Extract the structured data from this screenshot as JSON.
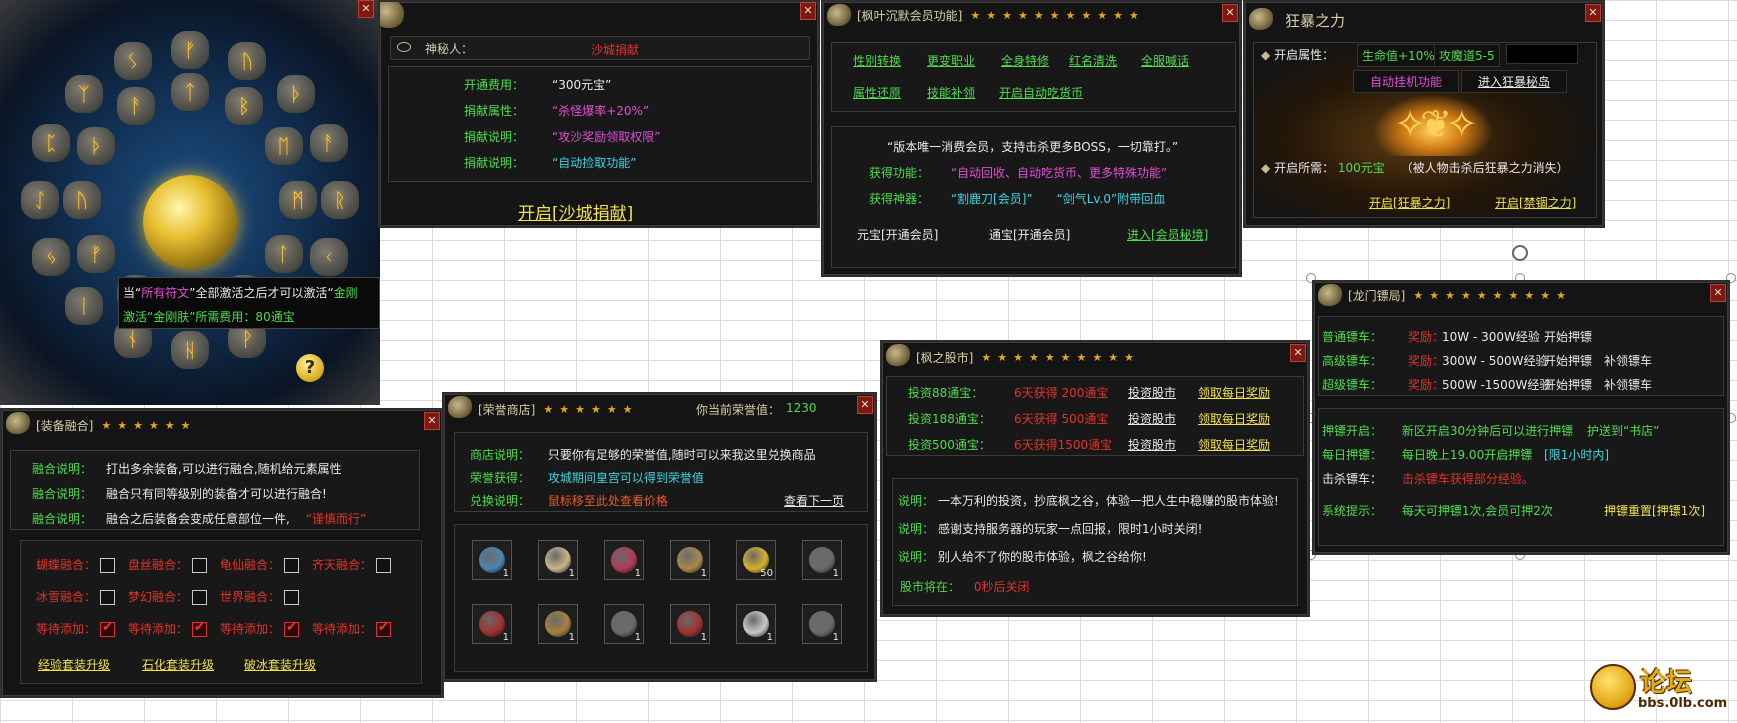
{
  "rune_panel": {
    "tooltip_line1_a": "当“",
    "tooltip_line1_rune": "所有符文",
    "tooltip_line1_b": "”全部激活之后才可以激活“",
    "tooltip_line1_c": "金刚",
    "tooltip_line2": "激活“金刚肤”所需费用：80通宝",
    "rune_glyphs": [
      "ᚠ",
      "ᚢ",
      "ᚦ",
      "ᚨ",
      "ᚱ",
      "ᚲ",
      "ᚷ",
      "ᚹ",
      "ᚺ",
      "ᚾ",
      "ᛁ",
      "ᛃ",
      "ᛇ",
      "ᛈ",
      "ᛉ",
      "ᛊ",
      "ᛏ",
      "ᛒ",
      "ᛖ",
      "ᛗ",
      "ᛚ",
      "ᛜ",
      "ᛞ",
      "ᛟ"
    ]
  },
  "shacheng": {
    "mystery_label": "神秘人：",
    "mystery_value": "沙城捐献",
    "rows": [
      {
        "label": "开通费用：",
        "value": "“300元宝”",
        "color": "#e8e8e8"
      },
      {
        "label": "捐献属性：",
        "value": "“杀怪爆率+20%”",
        "color": "#e04fd6"
      },
      {
        "label": "捐献说明：",
        "value": "“攻沙奖励领取权限”",
        "color": "#e04fd6"
      },
      {
        "label": "捐献说明：",
        "value": "“自动捡取功能”",
        "color": "#3fd6e0"
      }
    ],
    "open_link": "开启[沙城捐献]"
  },
  "member": {
    "title": "[枫叶沉默会员功能]",
    "stars": "★★★★★★★★★★★",
    "links_row1": [
      "性别转换",
      "更变职业",
      "全身特修",
      "红名清洗",
      "全服喊话"
    ],
    "links_row2": [
      "属性还原",
      "技能补领",
      "开启自动吃货币"
    ],
    "slogan": "“版本唯一消费会员，支持击杀更多BOSS，一切靠打。”",
    "func_label": "获得功能：",
    "func_value": "“自动回收、自动吃货币、更多特殊功能”",
    "weapon_label": "获得神器：",
    "weapon_value1": "“割鹿刀[会员]”",
    "weapon_value2": "“剑气Lv.0”附带回血",
    "btn_yuanbao": "元宝[开通会员]",
    "btn_tongbao": "通宝[开通会员]",
    "enter_link": "进入[会员秘境]"
  },
  "berserk": {
    "title": "狂暴之力",
    "attr_label": "开启属性：",
    "attr_hp": "生命值+10%",
    "attr_atk": "攻魔道5-5",
    "auto_btn": "自动挂机功能",
    "enter_island": "进入狂暴秘岛",
    "cost_label": "开启所需：",
    "cost_value": "100元宝",
    "cost_note": "（被人物击杀后狂暴之力消失）",
    "open_link": "开启[狂暴之力]",
    "ban_link": "开启[禁锢之力]"
  },
  "escort": {
    "title": "[龙门镖局]",
    "stars": "★★★★★★★★★★",
    "rows": [
      {
        "type": "普通镖车：",
        "reward_label": "奖励：",
        "reward": "10W - 300W经验",
        "a1": "开始押镖",
        "a2": ""
      },
      {
        "type": "高级镖车：",
        "reward_label": "奖励：",
        "reward": "300W - 500W经验",
        "a1": "开始押镖",
        "a2": "补领镖车"
      },
      {
        "type": "超级镖车：",
        "reward_label": "奖励：",
        "reward": "500W -1500W经验",
        "a1": "开始押镖",
        "a2": "补领镖车"
      }
    ],
    "open_label": "押镖开启：",
    "open_value": "新区开启30分钟后可以进行押镖",
    "open_value2": "护送到“书店”",
    "daily_label": "每日押镖：",
    "daily_value": "每日晚上19.00开启押镖",
    "daily_value2": "[限1小时内]",
    "kill_label": "击杀镖车：",
    "kill_value": "击杀镖车获得部分经验。",
    "sys_label": "系统提示：",
    "sys_value": "每天可押镖1次,会员可押2次",
    "reset_link": "押镖重置[押镖1次]"
  },
  "stock": {
    "title": "[枫之股市]",
    "stars": "★★★★★★★★★★",
    "rows": [
      {
        "label": "投资88通宝：",
        "gain": "6天获得 200通宝",
        "invest": "投资股市",
        "daily": "领取每日奖励"
      },
      {
        "label": "投资188通宝：",
        "gain": "6天获得 500通宝",
        "invest": "投资股市",
        "daily": "领取每日奖励"
      },
      {
        "label": "投资500通宝：",
        "gain": "6天获得1500通宝",
        "invest": "投资股市",
        "daily": "领取每日奖励"
      }
    ],
    "notes": [
      {
        "label": "说明：",
        "text": "一本万利的投资，抄底枫之谷，体验一把人生中稳赚的股市体验!"
      },
      {
        "label": "说明：",
        "text": "感谢支持服务器的玩家一点回报，限时1小时关闭!"
      },
      {
        "label": "说明：",
        "text": "别人给不了你的股市体验，枫之谷给你!"
      }
    ],
    "status_label": "股市将在：",
    "status_value": "0秒后关闭"
  },
  "fusion": {
    "title": "[装备融合]",
    "stars": "★★★★★★",
    "notes": [
      {
        "label": "融合说明：",
        "text": "打出多余装备,可以进行融合,随机给元素属性",
        "extra": ""
      },
      {
        "label": "融合说明：",
        "text": "融合只有同等级别的装备才可以进行融合!",
        "extra": ""
      },
      {
        "label": "融合说明：",
        "text": "融合之后装备会变成任意部位一件,",
        "extra": "“谨慎而行”"
      }
    ],
    "checks_row1": [
      "蝴蝶融合：",
      "盘丝融合：",
      "龟仙融合：",
      "齐天融合："
    ],
    "checks_row2": [
      "冰雪融合：",
      "梦幻融合：",
      "世界融合："
    ],
    "checks_row3": [
      "等待添加：",
      "等待添加：",
      "等待添加：",
      "等待添加："
    ],
    "links": [
      "经验套装升级",
      "石化套装升级",
      "破冰套装升级"
    ]
  },
  "honor": {
    "title": "[荣誉商店]",
    "stars": "★★★★★★",
    "honor_label": "你当前荣誉值：",
    "honor_value": "1230",
    "shop_label": "商店说明：",
    "shop_text": "只要你有足够的荣誉值,随时可以来我这里兑换商品",
    "get_label": "荣誉获得：",
    "get_text": "攻城期间皇宫可以得到荣誉值",
    "exchange_label": "兑换说明：",
    "exchange_text": "鼠标移至此处查看价格",
    "next_link": "查看下一页",
    "items_row1": [
      {
        "name": "crystal-item",
        "count": "1",
        "color": "#4a86b0"
      },
      {
        "name": "rice-bowl-item",
        "count": "1",
        "color": "#c9b48a"
      },
      {
        "name": "potion-item",
        "count": "1",
        "color": "#b03a5a"
      },
      {
        "name": "book-item",
        "count": "1",
        "color": "#a88a4a"
      },
      {
        "name": "bell-item",
        "count": "50",
        "color": "#d8b02a"
      },
      {
        "name": "chain-item",
        "count": "1",
        "color": "#6a6a6a"
      }
    ],
    "items_row2": [
      {
        "name": "red-ring-item",
        "count": "1",
        "color": "#a03030"
      },
      {
        "name": "gold-ring-item",
        "count": "1",
        "color": "#a88040"
      },
      {
        "name": "chain-item",
        "count": "1",
        "color": "#6a6a6a"
      },
      {
        "name": "red-ring-item",
        "count": "1",
        "color": "#a03030"
      },
      {
        "name": "white-ring-item",
        "count": "1",
        "color": "#c8c8c8"
      },
      {
        "name": "chain-item",
        "count": "1",
        "color": "#6a6a6a"
      }
    ]
  },
  "watermark": {
    "line1": "论坛",
    "line2": "bbs.0lb.com"
  }
}
